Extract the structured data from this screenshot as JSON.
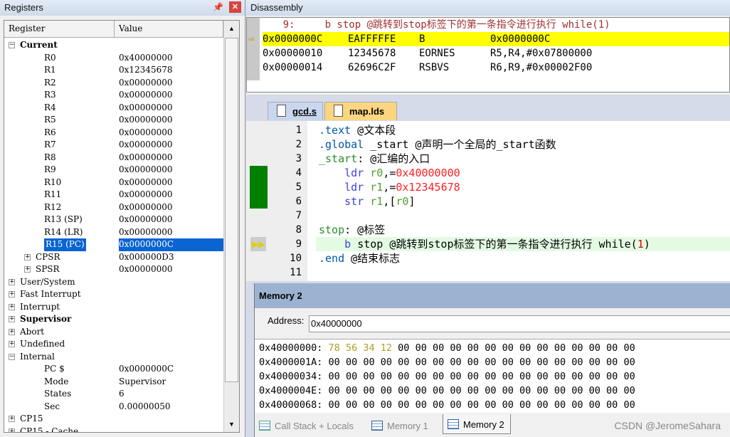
{
  "registers": {
    "title": "Registers",
    "col_register": "Register",
    "col_value": "Value",
    "rows": [
      {
        "label": "Current",
        "value": "",
        "level": 0,
        "toggle": "-",
        "bold": true
      },
      {
        "label": "R0",
        "value": "0x40000000",
        "level": 1
      },
      {
        "label": "R1",
        "value": "0x12345678",
        "level": 1
      },
      {
        "label": "R2",
        "value": "0x00000000",
        "level": 1
      },
      {
        "label": "R3",
        "value": "0x00000000",
        "level": 1
      },
      {
        "label": "R4",
        "value": "0x00000000",
        "level": 1
      },
      {
        "label": "R5",
        "value": "0x00000000",
        "level": 1
      },
      {
        "label": "R6",
        "value": "0x00000000",
        "level": 1
      },
      {
        "label": "R7",
        "value": "0x00000000",
        "level": 1
      },
      {
        "label": "R8",
        "value": "0x00000000",
        "level": 1
      },
      {
        "label": "R9",
        "value": "0x00000000",
        "level": 1
      },
      {
        "label": "R10",
        "value": "0x00000000",
        "level": 1
      },
      {
        "label": "R11",
        "value": "0x00000000",
        "level": 1
      },
      {
        "label": "R12",
        "value": "0x00000000",
        "level": 1
      },
      {
        "label": "R13 (SP)",
        "value": "0x00000000",
        "level": 1
      },
      {
        "label": "R14 (LR)",
        "value": "0x00000000",
        "level": 1
      },
      {
        "label": "R15 (PC)",
        "value": "0x0000000C",
        "level": 1,
        "selected": true
      },
      {
        "label": "CPSR",
        "value": "0x000000D3",
        "level": 1,
        "toggle": "+"
      },
      {
        "label": "SPSR",
        "value": "0x00000000",
        "level": 1,
        "toggle": "+"
      },
      {
        "label": "User/System",
        "value": "",
        "level": 0,
        "toggle": "+"
      },
      {
        "label": "Fast Interrupt",
        "value": "",
        "level": 0,
        "toggle": "+"
      },
      {
        "label": "Interrupt",
        "value": "",
        "level": 0,
        "toggle": "+"
      },
      {
        "label": "Supervisor",
        "value": "",
        "level": 0,
        "toggle": "+",
        "bold": true
      },
      {
        "label": "Abort",
        "value": "",
        "level": 0,
        "toggle": "+"
      },
      {
        "label": "Undefined",
        "value": "",
        "level": 0,
        "toggle": "+"
      },
      {
        "label": "Internal",
        "value": "",
        "level": 0,
        "toggle": "-"
      },
      {
        "label": "PC  $",
        "value": "0x0000000C",
        "level": 1
      },
      {
        "label": "Mode",
        "value": "Supervisor",
        "level": 1
      },
      {
        "label": "States",
        "value": "6",
        "level": 1
      },
      {
        "label": "Sec",
        "value": "0.00000050",
        "level": 1
      },
      {
        "label": "CP15",
        "value": "",
        "level": 0,
        "toggle": "+"
      },
      {
        "label": "CP15 - Cache",
        "value": "",
        "level": 0,
        "toggle": "+"
      }
    ]
  },
  "disassembly": {
    "title": "Disassembly",
    "source_line": "      9:     b stop @跳转到stop标签下的第一条指令进行执行 while(1)",
    "lines": [
      {
        "addr": "0x0000000C",
        "opcode": "EAFFFFFE",
        "mnemonic": "B",
        "operands": "0x0000000C",
        "current": true
      },
      {
        "addr": "0x00000010",
        "opcode": "12345678",
        "mnemonic": "EORNES",
        "operands": "R5,R4,#0x07800000"
      },
      {
        "addr": "0x00000014",
        "opcode": "62696C2F",
        "mnemonic": "RSBVS",
        "operands": "R6,R9,#0x00002F00"
      }
    ]
  },
  "editor": {
    "tabs": [
      {
        "label": "gcd.s",
        "active": true
      },
      {
        "label": "map.lds",
        "active": false
      }
    ],
    "lines": [
      {
        "n": "1",
        "tokens": [
          [
            ".text",
            "dir"
          ],
          [
            " @文本段",
            "txt"
          ]
        ]
      },
      {
        "n": "2",
        "tokens": [
          [
            ".global",
            "dir"
          ],
          [
            " _start @声明一个全局的_start函数",
            "txt"
          ]
        ]
      },
      {
        "n": "3",
        "tokens": [
          [
            "_start",
            "lbl"
          ],
          [
            ": @汇编的入口",
            "txt"
          ]
        ]
      },
      {
        "n": "4",
        "tokens": [
          [
            "    ldr ",
            "kw"
          ],
          [
            "r0",
            "reg"
          ],
          [
            ",=",
            "txt"
          ],
          [
            "0x40000000",
            "num"
          ]
        ],
        "executed": true
      },
      {
        "n": "5",
        "tokens": [
          [
            "    ldr ",
            "kw"
          ],
          [
            "r1",
            "reg"
          ],
          [
            ",=",
            "txt"
          ],
          [
            "0x12345678",
            "num"
          ]
        ],
        "executed": true
      },
      {
        "n": "6",
        "tokens": [
          [
            "    str ",
            "kw"
          ],
          [
            "r1",
            "reg"
          ],
          [
            ",[",
            "txt"
          ],
          [
            "r0",
            "reg"
          ],
          [
            "]",
            "txt"
          ]
        ],
        "executed": true
      },
      {
        "n": "7",
        "tokens": []
      },
      {
        "n": "8",
        "tokens": [
          [
            "stop",
            "lbl"
          ],
          [
            ": @标签",
            "txt"
          ]
        ]
      },
      {
        "n": "9",
        "tokens": [
          [
            "    b ",
            "kw"
          ],
          [
            "stop @跳转到stop标签下的第一条指令进行执行 while(",
            "txt"
          ],
          [
            "1",
            "red"
          ],
          [
            ")",
            "txt"
          ]
        ],
        "current": true
      },
      {
        "n": "10",
        "tokens": [
          [
            ".end",
            "dir"
          ],
          [
            " @结束标志",
            "txt"
          ]
        ]
      },
      {
        "n": "11",
        "tokens": []
      }
    ]
  },
  "memory": {
    "title": "Memory 2",
    "address_label": "Address:",
    "address_value": "0x40000000",
    "rows": [
      {
        "addr": "0x40000000:",
        "bytes": [
          "78",
          "56",
          "34",
          "12",
          "00",
          "00",
          "00",
          "00",
          "00",
          "00",
          "00",
          "00",
          "00",
          "00",
          "00",
          "00",
          "00",
          "00"
        ],
        "changed": 4
      },
      {
        "addr": "0x4000001A:",
        "bytes": [
          "00",
          "00",
          "00",
          "00",
          "00",
          "00",
          "00",
          "00",
          "00",
          "00",
          "00",
          "00",
          "00",
          "00",
          "00",
          "00",
          "00",
          "00"
        ]
      },
      {
        "addr": "0x40000034:",
        "bytes": [
          "00",
          "00",
          "00",
          "00",
          "00",
          "00",
          "00",
          "00",
          "00",
          "00",
          "00",
          "00",
          "00",
          "00",
          "00",
          "00",
          "00",
          "00"
        ]
      },
      {
        "addr": "0x4000004E:",
        "bytes": [
          "00",
          "00",
          "00",
          "00",
          "00",
          "00",
          "00",
          "00",
          "00",
          "00",
          "00",
          "00",
          "00",
          "00",
          "00",
          "00",
          "00",
          "00"
        ]
      },
      {
        "addr": "0x40000068:",
        "bytes": [
          "00",
          "00",
          "00",
          "00",
          "00",
          "00",
          "00",
          "00",
          "00",
          "00",
          "00",
          "00",
          "00",
          "00",
          "00",
          "00",
          "00",
          "00"
        ]
      }
    ],
    "tabs": [
      {
        "label": "Call Stack + Locals"
      },
      {
        "label": "Memory 1"
      },
      {
        "label": "Memory 2",
        "active": true
      }
    ],
    "watermark": "CSDN @JeromeSahara"
  },
  "colors": {
    "current_line": "#ffff00",
    "executed": "#008000",
    "selection": "#0a64d2"
  }
}
